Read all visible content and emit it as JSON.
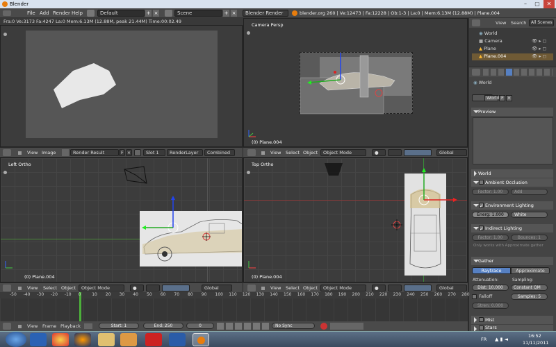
{
  "window": {
    "title": "Blender",
    "minimize": "–",
    "maximize": "▢",
    "close": "✕"
  },
  "menubar": {
    "items": [
      "File",
      "Add",
      "Render",
      "Help"
    ],
    "layout": "Default",
    "scene": "Scene",
    "engine": "Blender Render",
    "stats": "blender.org 260 | Ve:12473 | Fa:12228 | Ob:1-3 | La:0 | Mem:6.13M (12.88M) | Plane.004"
  },
  "infobar": "Fra:0  Ve:3173 Fa:4247 La:0 Mem:6.13M (12.88M, peak 21.44M) Time:00:02.49",
  "camera_view": {
    "label": "Camera Persp",
    "object": "(0) Plane.004"
  },
  "render_header": {
    "view": "View",
    "image": "Image",
    "result": "Render Result",
    "slot": "Slot 1",
    "layer": "RenderLayer",
    "pass": "Combined",
    "f": "F"
  },
  "cam_header": {
    "view": "View",
    "select": "Select",
    "object": "Object",
    "mode": "Object Mode",
    "orient": "Global"
  },
  "left_view": {
    "label": "Left Ortho",
    "object": "(0) Plane.004"
  },
  "top_view": {
    "label": "Top Ortho",
    "object": "(0) Plane.004"
  },
  "left_header": {
    "view": "View",
    "select": "Select",
    "object": "Object",
    "mode": "Object Mode",
    "orient": "Global"
  },
  "top_header": {
    "view": "View",
    "select": "Select",
    "object": "Object",
    "mode": "Object Mode",
    "orient": "Global"
  },
  "outliner": {
    "view": "View",
    "search": "Search",
    "scenes": "All Scenes",
    "items": [
      "World",
      "Camera",
      "Plane",
      "Plane.004"
    ]
  },
  "properties": {
    "breadcrumb": "World",
    "world_name": "World",
    "world_f": "F",
    "preview": "Preview",
    "world_panel": "World",
    "ambient_occlusion": "Ambient Occlusion",
    "ao_factor": "Factor: 1.00",
    "ao_mode": "Add",
    "env_lighting": "Environment Lighting",
    "env_energy": "Energ: 1.000",
    "env_color": "White",
    "indirect": "Indirect Lighting",
    "ind_factor": "Factor: 1.00",
    "ind_bounces": "Bounces: 1",
    "ind_note": "Only works with Approximate gather",
    "gather": "Gather",
    "raytrace": "Raytrace",
    "approximate": "Approximate",
    "attenuation": "Attenuation:",
    "sampling": "Sampling:",
    "dist": "Dist: 10.000",
    "sampling_mode": "Constant QM",
    "falloff": "Falloff",
    "samples": "Samples: 5",
    "strength": "Stren: 0.000",
    "mist": "Mist",
    "stars": "Stars"
  },
  "timeline": {
    "ticks": [
      "-50",
      "-40",
      "-30",
      "-20",
      "-10",
      "0",
      "10",
      "20",
      "30",
      "40",
      "50",
      "60",
      "70",
      "80",
      "90",
      "100",
      "110",
      "120",
      "130",
      "140",
      "150",
      "160",
      "170",
      "180",
      "190",
      "200",
      "210",
      "220",
      "230",
      "240",
      "250",
      "260",
      "270",
      "280"
    ],
    "view": "View",
    "frame": "Frame",
    "playback": "Playback",
    "start": "Start: 1",
    "end": "End: 250",
    "current": "0",
    "sync": "No Sync"
  },
  "taskbar": {
    "lang": "FR",
    "time": "16:52",
    "date": "11/11/2011"
  }
}
